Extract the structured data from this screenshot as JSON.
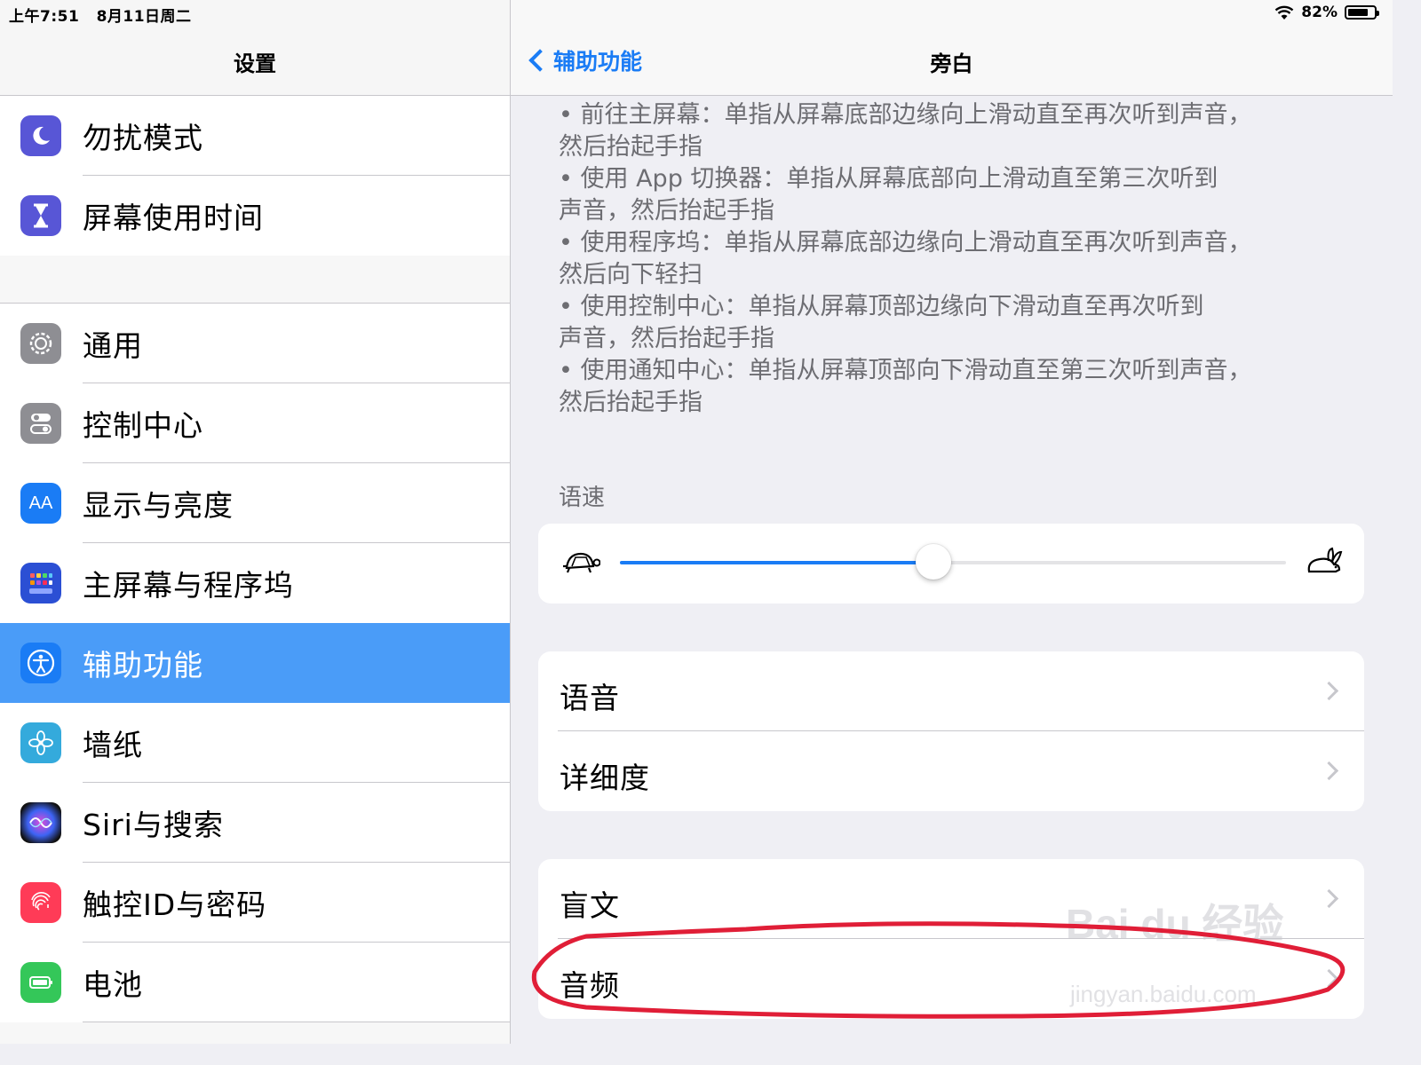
{
  "status": {
    "time": "上午7:51",
    "date": "8月11日周二",
    "battery": "82%",
    "battery_level": 0.82
  },
  "master": {
    "title": "设置",
    "group1": [
      {
        "label": "勿扰模式",
        "icon": "moon-icon",
        "color": "#5856d6"
      },
      {
        "label": "屏幕使用时间",
        "icon": "hourglass-icon",
        "color": "#5856d6"
      }
    ],
    "group2": [
      {
        "label": "通用",
        "icon": "gear-icon",
        "color": "#8e8e93"
      },
      {
        "label": "控制中心",
        "icon": "toggles-icon",
        "color": "#8e8e93"
      },
      {
        "label": "显示与亮度",
        "icon": "aa-icon",
        "color": "#1a7cf5"
      },
      {
        "label": "主屏幕与程序坞",
        "icon": "grid-icon",
        "color": "#2b4fd4"
      },
      {
        "label": "辅助功能",
        "icon": "accessibility-icon",
        "color": "#1a7cf5",
        "selected": true
      },
      {
        "label": "墙纸",
        "icon": "flower-icon",
        "color": "#34aadc"
      },
      {
        "label": "Siri与搜索",
        "icon": "siri-icon",
        "color": "#222"
      },
      {
        "label": "触控ID与密码",
        "icon": "fingerprint-icon",
        "color": "#ff3b57"
      },
      {
        "label": "电池",
        "icon": "battery-icon",
        "color": "#34c759"
      }
    ]
  },
  "detail": {
    "back_label": "辅助功能",
    "title": "旁白",
    "notes": [
      "• 前往主屏幕：单指从屏幕底部边缘向上滑动直至再次听到声音，",
      "然后抬起手指",
      "• 使用 App 切换器：单指从屏幕底部向上滑动直至第三次听到",
      "声音，然后抬起手指",
      "• 使用程序坞：单指从屏幕底部边缘向上滑动直至再次听到声音，",
      "然后向下轻扫",
      "• 使用控制中心：单指从屏幕顶部边缘向下滑动直至再次听到",
      "声音，然后抬起手指",
      "• 使用通知中心：单指从屏幕顶部向下滑动直至第三次听到声音，",
      "然后抬起手指"
    ],
    "speed_header": "语速",
    "speed_value": 0.47,
    "section2": [
      "语音",
      "详细度"
    ],
    "section3": [
      "盲文",
      "音频"
    ]
  },
  "watermark": {
    "line1": "Bai du 经验",
    "line2": "jingyan.baidu.com"
  },
  "colors": {
    "accent": "#1a7cf5",
    "selected_row": "#4a9cf8",
    "annotation": "#e01e37"
  }
}
